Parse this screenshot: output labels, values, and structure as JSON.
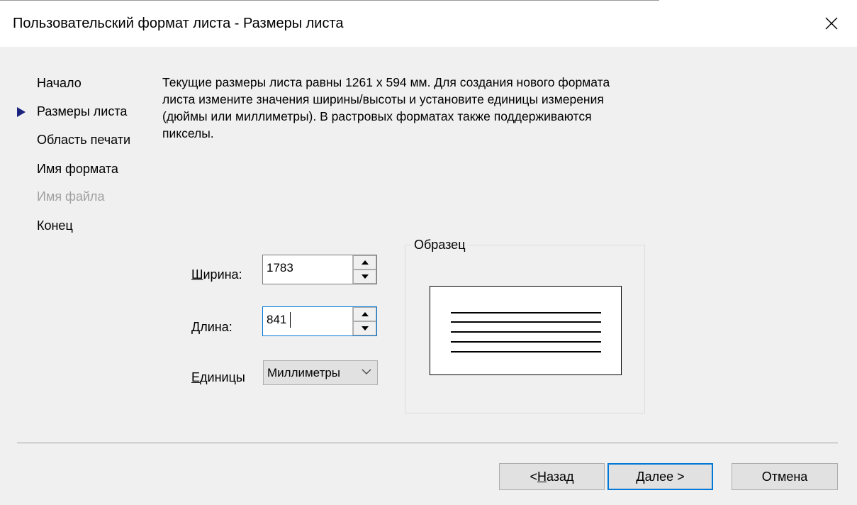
{
  "window": {
    "title": "Пользовательский формат листа - Размеры листа",
    "close_icon": "close-icon"
  },
  "nav": {
    "items": [
      {
        "label": "Начало",
        "state": "normal"
      },
      {
        "label": "Размеры листа",
        "state": "current"
      },
      {
        "label": "Область печати",
        "state": "normal"
      },
      {
        "label": "Имя формата",
        "state": "normal"
      },
      {
        "label": "Имя файла",
        "state": "disabled"
      },
      {
        "label": "Конец",
        "state": "normal"
      }
    ],
    "current_marker_icon": "arrow-right-icon",
    "marker_color": "#1a237e"
  },
  "description": "Текущие размеры листа равны 1261 x 594 мм. Для создания нового формата листа измените значения ширины/высоты и установите единицы измерения (дюймы или миллиметры). В растровых форматах также поддерживаются пикселы.",
  "fields": {
    "width": {
      "label_accel": "Ш",
      "label_rest": "ирина:",
      "value": "1783"
    },
    "length": {
      "label_accel": "Д",
      "label_rest": "лина:",
      "value": "841"
    },
    "units": {
      "label_accel": "Е",
      "label_rest": "диницы",
      "value": "Миллиметры"
    }
  },
  "preview": {
    "label": "Образец",
    "line_count": 5
  },
  "buttons": {
    "back": {
      "prefix": "< ",
      "accel": "Н",
      "rest": "азад"
    },
    "next": {
      "accel": "Д",
      "rest": "алее >"
    },
    "cancel": {
      "label": "Отмена"
    }
  },
  "colors": {
    "focus_accent": "#0078d7",
    "dialog_bg": "#f0f0f0",
    "disabled_text": "#a0a0a0"
  }
}
